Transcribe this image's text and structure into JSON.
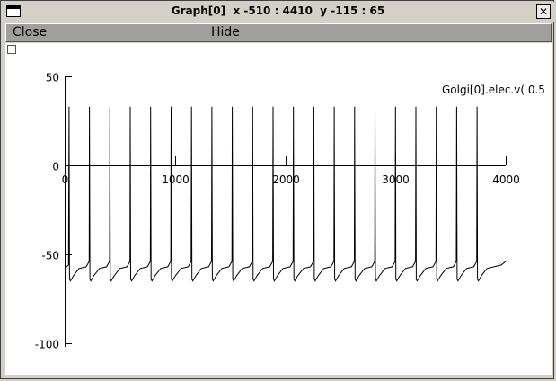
{
  "window": {
    "title": "Graph[0]  x -510 : 4410  y -115 : 65",
    "close_glyph": "✕"
  },
  "menu": {
    "close_label": "Close",
    "hide_label": "Hide"
  },
  "chart_data": {
    "type": "line",
    "series": [
      {
        "name": "Golgi[0].elec.v( 0.5",
        "spike_times": [
          40,
          225,
          410,
          595,
          780,
          965,
          1150,
          1335,
          1520,
          1705,
          1890,
          2075,
          2260,
          2445,
          2630,
          2815,
          3000,
          3185,
          3370,
          3555,
          3740
        ],
        "spike_peak": 33,
        "trough": -64,
        "pre_spike": -54,
        "start_value": -58,
        "end_value": -54
      }
    ],
    "x_ticks": [
      "0",
      "1000",
      "2000",
      "3000",
      "4000"
    ],
    "y_ticks": [
      "50",
      "0",
      "-50",
      "-100"
    ],
    "x_axis_range": [
      0,
      4000
    ],
    "y_axis_range": [
      -100,
      50
    ],
    "view_range_x": [
      -510,
      4410
    ],
    "view_range_y": [
      -115,
      65
    ]
  }
}
